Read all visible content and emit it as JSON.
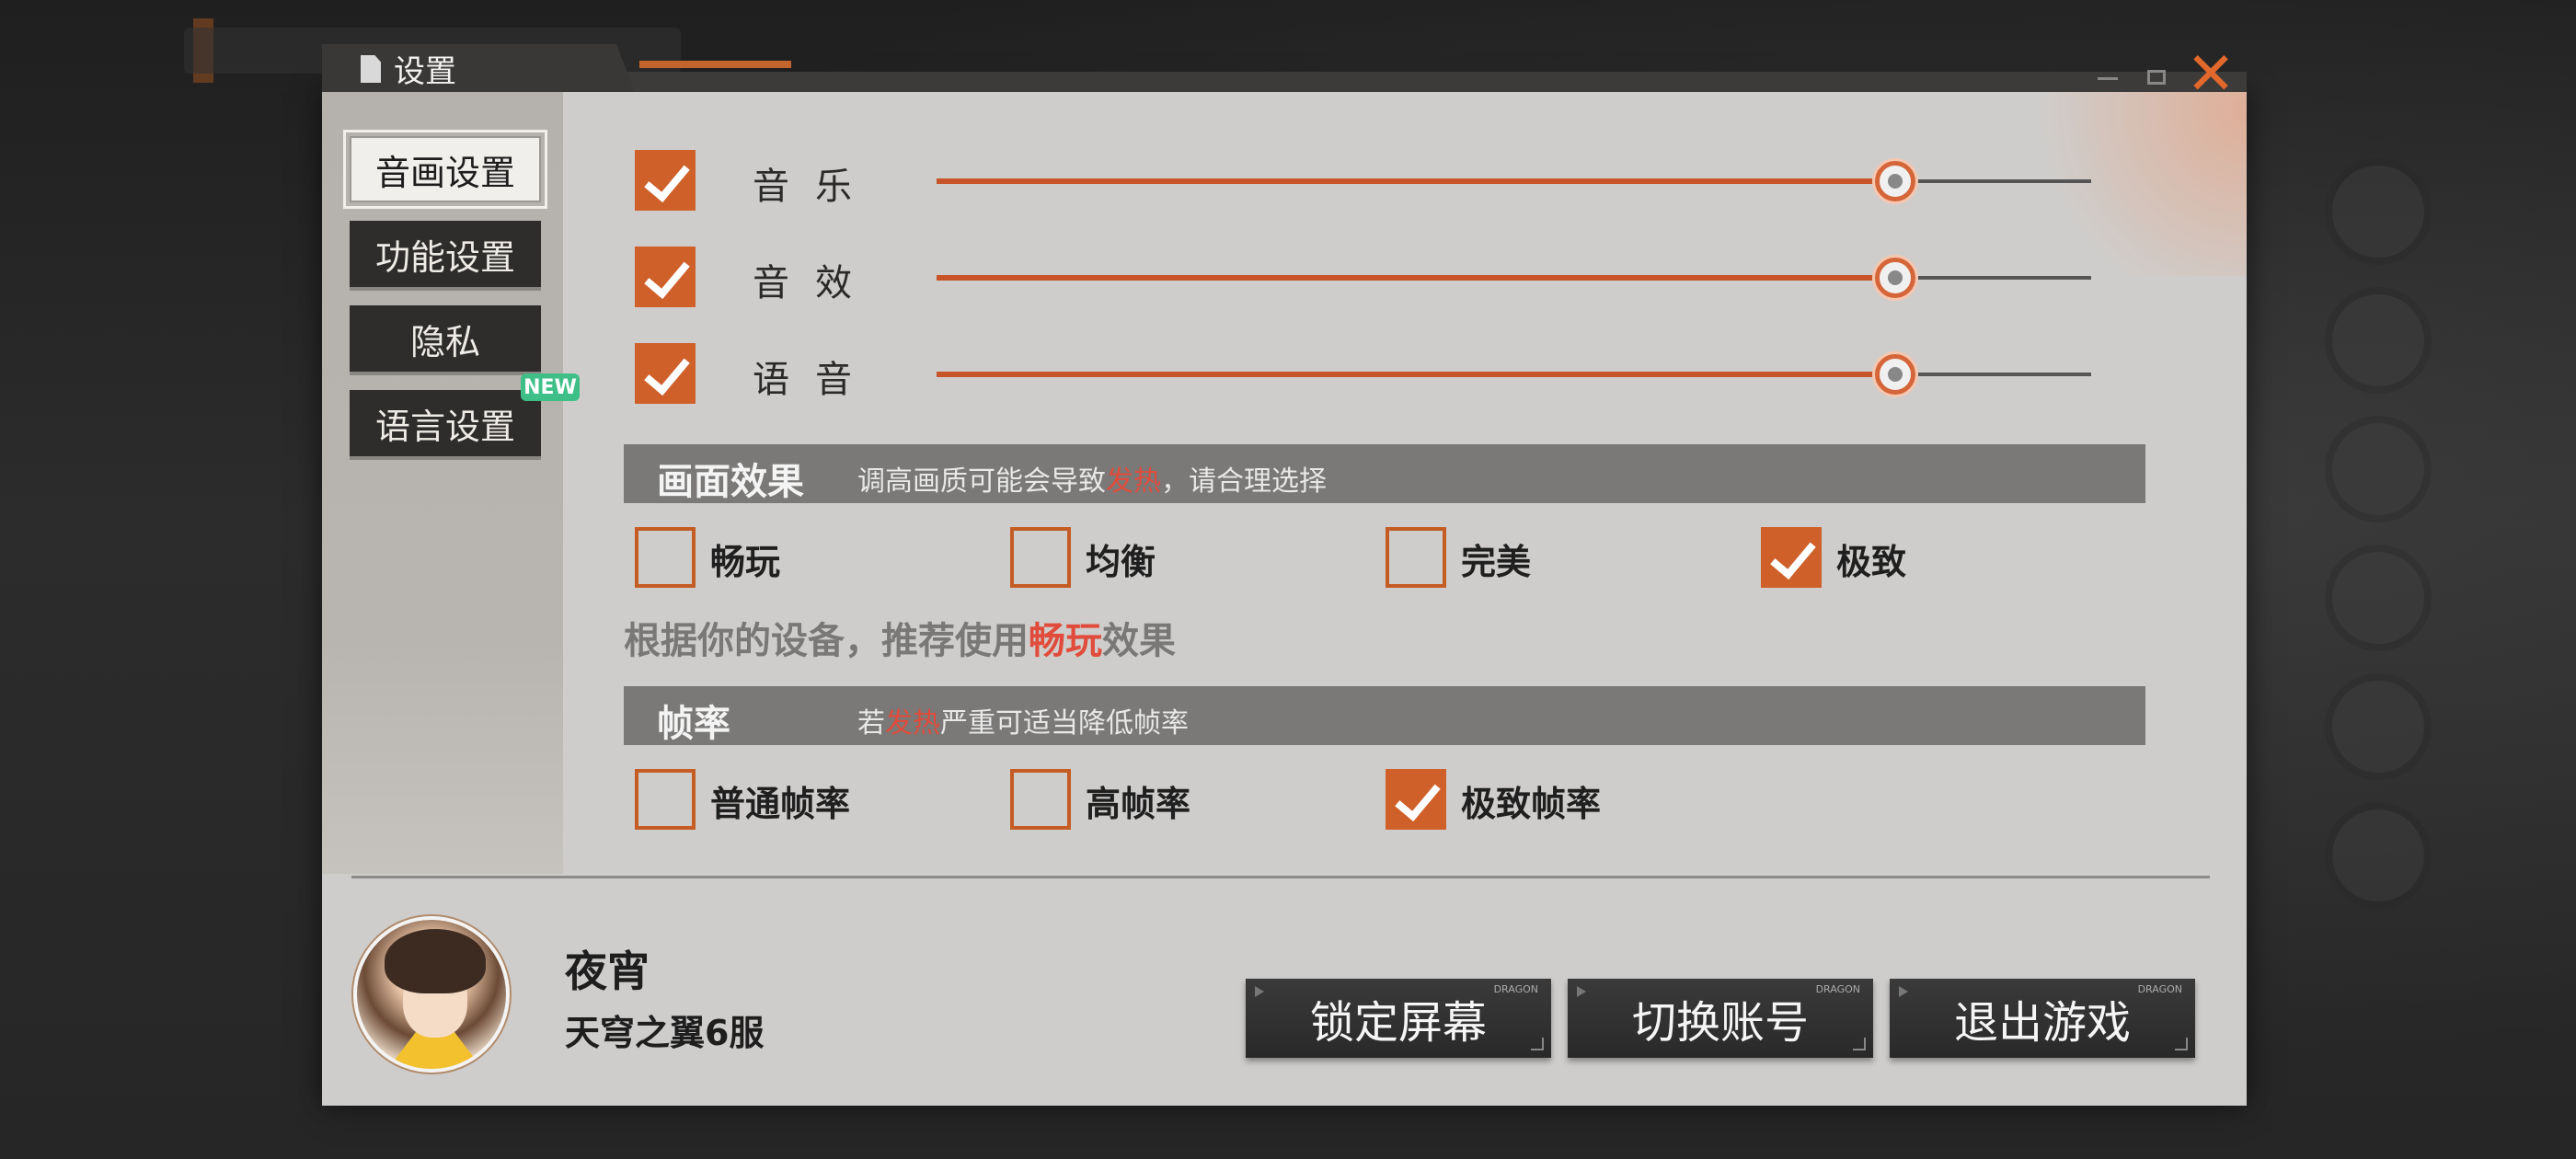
{
  "dialog": {
    "title": "设置",
    "close_icon": "close-x-icon"
  },
  "sidebar": {
    "items": [
      {
        "label": "音画设置",
        "active": true
      },
      {
        "label": "功能设置",
        "active": false
      },
      {
        "label": "隐私",
        "active": false
      },
      {
        "label": "语言设置",
        "active": false,
        "badge": "NEW"
      }
    ]
  },
  "volume": [
    {
      "label": "音乐",
      "enabled": true,
      "level": 0.83
    },
    {
      "label": "音效",
      "enabled": true,
      "level": 0.83
    },
    {
      "label": "语音",
      "enabled": true,
      "level": 0.83
    }
  ],
  "graphics": {
    "title": "画面效果",
    "hint_before": "调高画质可能会导致",
    "hint_hot": "发热",
    "hint_after": "，请合理选择",
    "options": [
      {
        "label": "畅玩",
        "checked": false
      },
      {
        "label": "均衡",
        "checked": false
      },
      {
        "label": "完美",
        "checked": false
      },
      {
        "label": "极致",
        "checked": true
      }
    ],
    "recommend_before": "根据你的设备，推荐使用",
    "recommend_highlight": "畅玩",
    "recommend_after": "效果"
  },
  "framerate": {
    "title": "帧率",
    "hint_before": "若",
    "hint_hot": "发热",
    "hint_after": "严重可适当降低帧率",
    "options": [
      {
        "label": "普通帧率",
        "checked": false
      },
      {
        "label": "高帧率",
        "checked": false
      },
      {
        "label": "极致帧率",
        "checked": true
      }
    ]
  },
  "profile": {
    "name": "夜宵",
    "server": "天穹之翼6服"
  },
  "actions": {
    "lock_screen": "锁定屏幕",
    "switch_account": "切换账号",
    "exit_game": "退出游戏",
    "button_tag": "DRAGON"
  },
  "colors": {
    "accent": "#d0602a",
    "hot_text": "#e14b3b",
    "new_badge": "#3fbf88"
  }
}
